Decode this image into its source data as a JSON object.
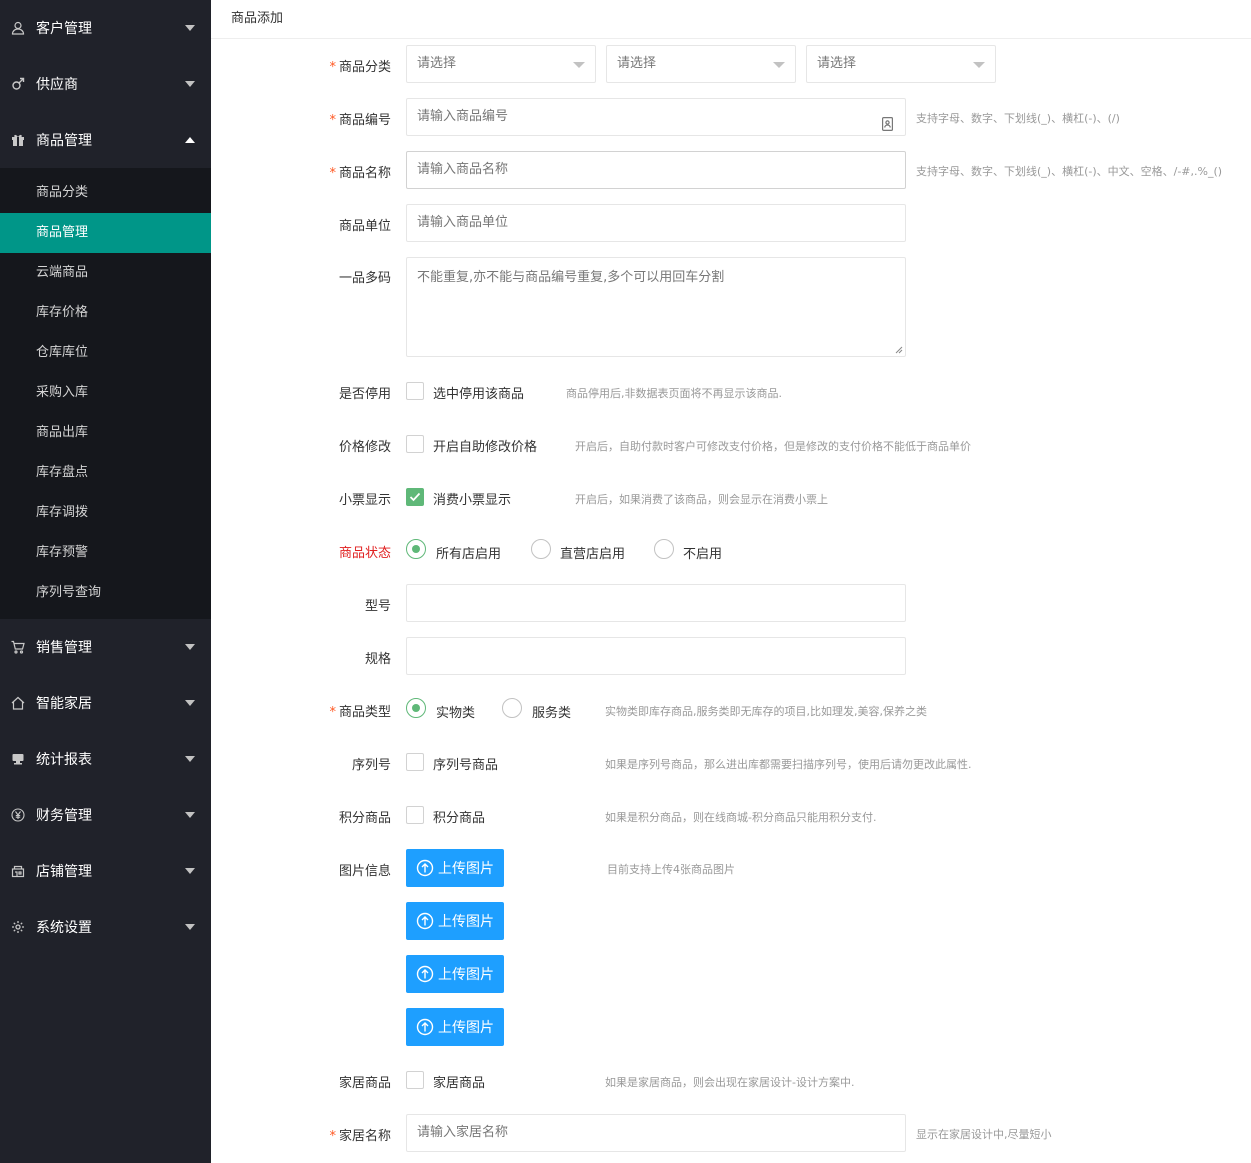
{
  "sidebar": {
    "groups_top": [
      {
        "label": "客户管理",
        "icon": "user-icon"
      },
      {
        "label": "供应商",
        "icon": "male-icon"
      },
      {
        "label": "商品管理",
        "icon": "gift-icon"
      }
    ],
    "sub_items": [
      {
        "label": "商品分类"
      },
      {
        "label": "商品管理",
        "active": true
      },
      {
        "label": "云端商品"
      },
      {
        "label": "库存价格"
      },
      {
        "label": "仓库库位"
      },
      {
        "label": "采购入库"
      },
      {
        "label": "商品出库"
      },
      {
        "label": "库存盘点"
      },
      {
        "label": "库存调拨"
      },
      {
        "label": "库存预警"
      },
      {
        "label": "序列号查询"
      }
    ],
    "groups_bottom": [
      {
        "label": "销售管理",
        "icon": "cart-icon"
      },
      {
        "label": "智能家居",
        "icon": "home-icon"
      },
      {
        "label": "统计报表",
        "icon": "report-icon"
      },
      {
        "label": "财务管理",
        "icon": "yen-icon"
      },
      {
        "label": "店铺管理",
        "icon": "shop-icon"
      },
      {
        "label": "系统设置",
        "icon": "gear-icon"
      }
    ],
    "active_color": "#009688"
  },
  "breadcrumb": "商品添加",
  "form": {
    "category": {
      "label": "商品分类",
      "selects": [
        "请选择",
        "请选择",
        "请选择"
      ]
    },
    "code": {
      "label": "商品编号",
      "placeholder": "请输入商品编号",
      "tip": "支持字母、数字、下划线(_)、横杠(-)、(/)"
    },
    "name": {
      "label": "商品名称",
      "placeholder": "请输入商品名称",
      "tip": "支持字母、数字、下划线(_)、横杠(-)、中文、空格、/-#,.%_()"
    },
    "unit": {
      "label": "商品单位",
      "placeholder": "请输入商品单位"
    },
    "multi_code": {
      "label": "一品多码",
      "placeholder": "不能重复,亦不能与商品编号重复,多个可以用回车分割"
    },
    "disabled": {
      "label": "是否停用",
      "checkbox": "选中停用该商品",
      "tip": "商品停用后,非数据表页面将不再显示该商品.",
      "checked": false
    },
    "price_edit": {
      "label": "价格修改",
      "checkbox": "开启自助修改价格",
      "tip": "开启后，自助付款时客户可修改支付价格，但是修改的支付价格不能低于商品单价",
      "checked": false
    },
    "receipt": {
      "label": "小票显示",
      "checkbox": "消费小票显示",
      "tip": "开启后，如果消费了该商品，则会显示在消费小票上",
      "checked": true
    },
    "status": {
      "label": "商品状态",
      "options": [
        "所有店启用",
        "直营店启用",
        "不启用"
      ],
      "selected": "所有店启用"
    },
    "model": {
      "label": "型号",
      "value": ""
    },
    "spec": {
      "label": "规格",
      "value": ""
    },
    "type": {
      "label": "商品类型",
      "options": [
        "实物类",
        "服务类"
      ],
      "selected": "实物类",
      "tip": "实物类即库存商品,服务类即无库存的项目,比如理发,美容,保养之类"
    },
    "serial": {
      "label": "序列号",
      "checkbox": "序列号商品",
      "tip": "如果是序列号商品，那么进出库都需要扫描序列号，使用后请勿更改此属性.",
      "checked": false
    },
    "points": {
      "label": "积分商品",
      "checkbox": "积分商品",
      "tip": "如果是积分商品，则在线商城-积分商品只能用积分支付.",
      "checked": false
    },
    "images": {
      "label": "图片信息",
      "buttons": [
        "上传图片",
        "上传图片",
        "上传图片",
        "上传图片"
      ],
      "tip": "目前支持上传4张商品图片"
    },
    "home_goods": {
      "label": "家居商品",
      "checkbox": "家居商品",
      "tip": "如果是家居商品，则会出现在家居设计-设计方案中.",
      "checked": false
    },
    "home_name": {
      "label": "家居名称",
      "placeholder": "请输入家居名称",
      "tip": "显示在家居设计中,尽量短小"
    }
  },
  "colors": {
    "primary_blue": "#1e9fff",
    "check_green": "#5fb878",
    "required_star": "#ff5722"
  }
}
